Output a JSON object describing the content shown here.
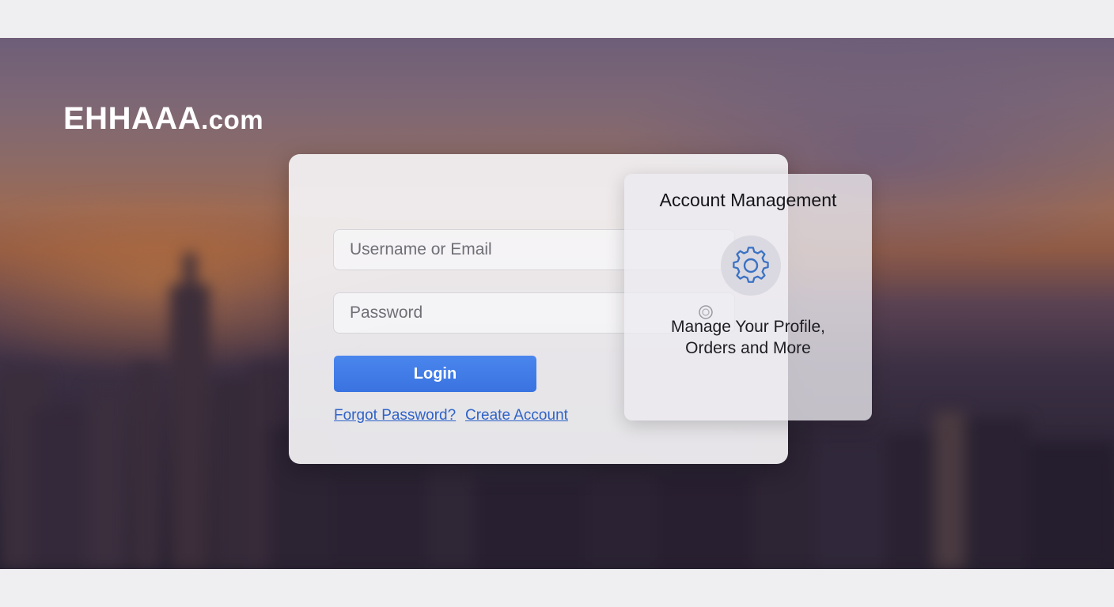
{
  "brand": {
    "name": "EHHAAA",
    "suffix": ".com"
  },
  "login": {
    "username_placeholder": "Username or Email",
    "password_placeholder": "Password",
    "login_label": "Login",
    "forgot_label": "Forgot Password?",
    "create_label": "Create Account"
  },
  "account": {
    "title": "Account Management",
    "subtitle_line1": "Manage Your Profile,",
    "subtitle_line2": "Orders and More",
    "icon": "gear-icon"
  },
  "colors": {
    "accent": "#3a73e0",
    "link": "#2f63c9",
    "icon": "#3b72c4"
  }
}
